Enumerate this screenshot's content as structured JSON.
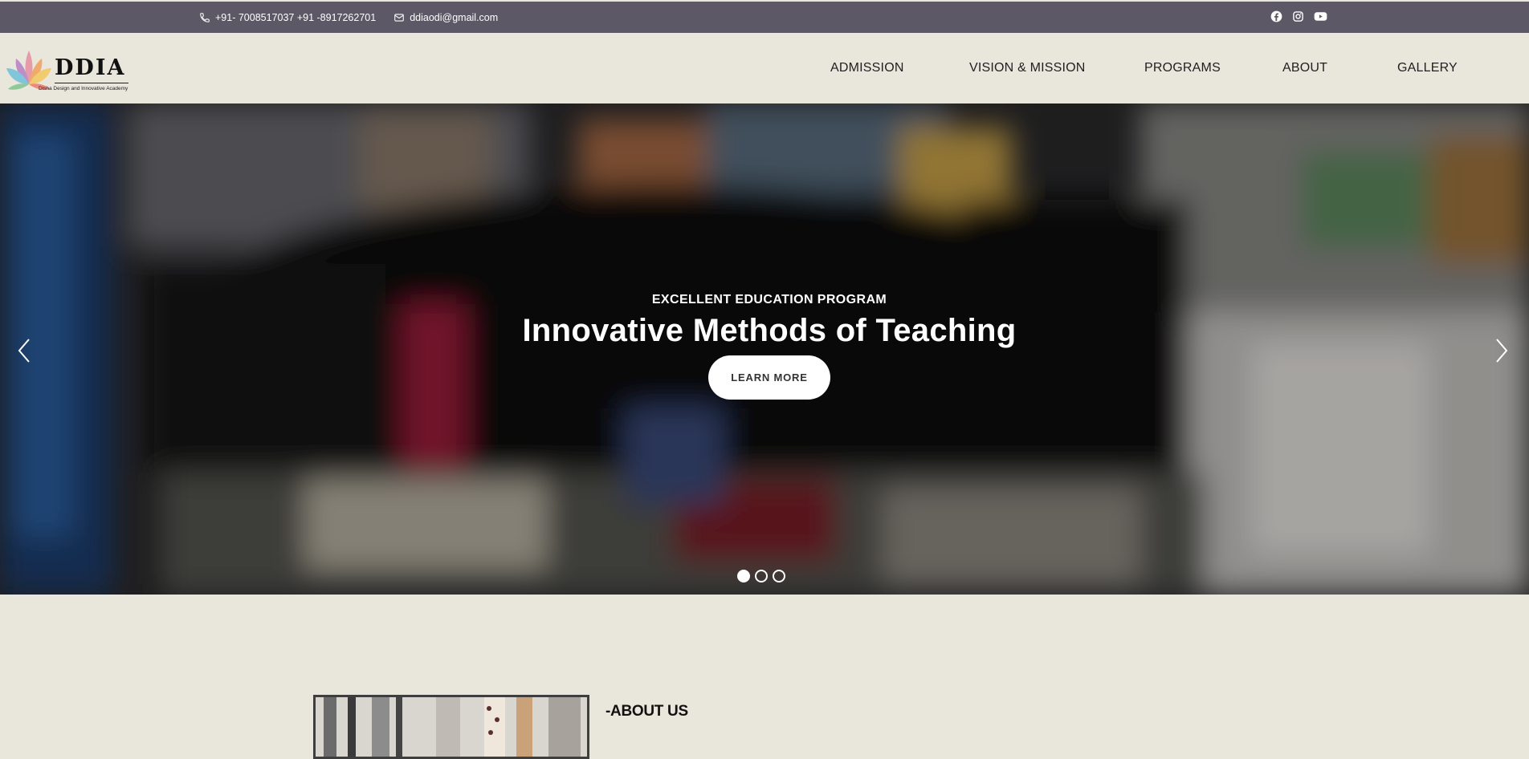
{
  "topbar": {
    "phone_icon": "phone-icon",
    "phones": "+91- 7008517037 +91 -8917262701",
    "email_icon": "envelope-icon",
    "email": "ddiaodi@gmail.com",
    "socials": [
      "facebook-icon",
      "instagram-icon",
      "youtube-icon"
    ]
  },
  "logo": {
    "name": "DDIA",
    "tagline": "Disha Design and Innovative Academy"
  },
  "nav": {
    "items": [
      "ADMISSION",
      "VISION & MISSION",
      "PROGRAMS",
      "ABOUT",
      "GALLERY"
    ]
  },
  "hero": {
    "eyebrow": "EXCELLENT EDUCATION PROGRAM",
    "headline": "Innovative Methods of Teaching",
    "cta_label": "LEARN MORE",
    "slide_count": 3,
    "active_slide": 1
  },
  "about": {
    "title": "-ABOUT US"
  },
  "colors": {
    "topbar_bg": "#5d5866",
    "page_bg": "#e9e6dc",
    "button_bg": "#ffffff"
  }
}
